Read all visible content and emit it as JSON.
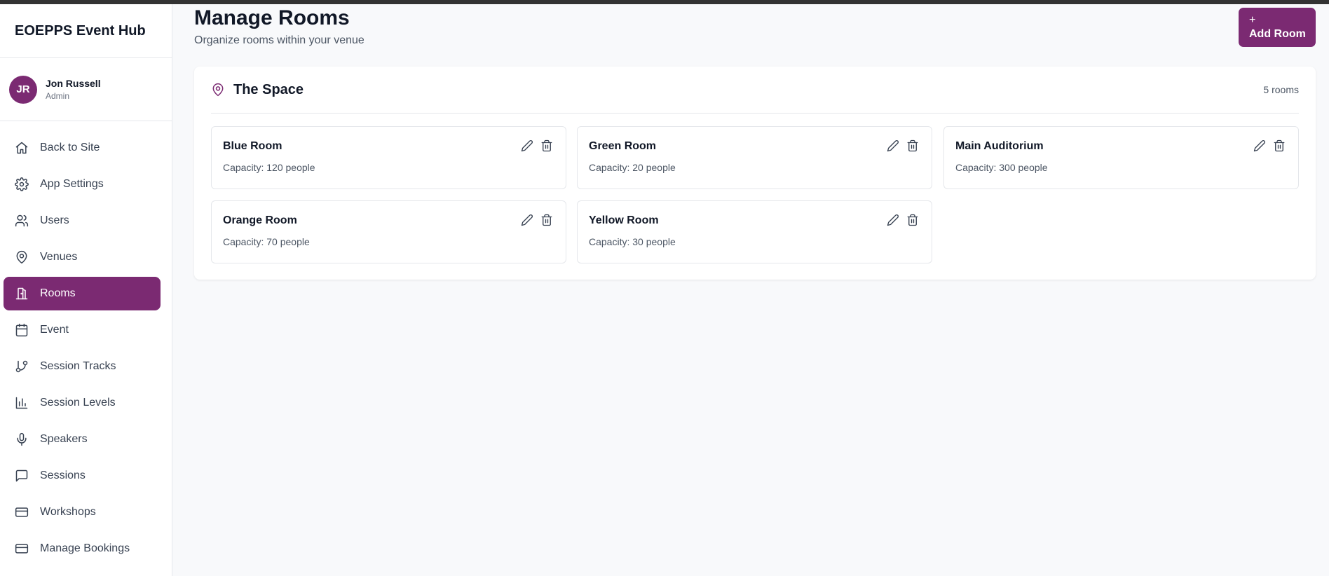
{
  "app": {
    "brand": "EOEPPS Event Hub"
  },
  "user": {
    "initials": "JR",
    "name": "Jon Russell",
    "role": "Admin"
  },
  "nav": [
    {
      "label": "Back to Site",
      "icon": "home-icon",
      "active": false
    },
    {
      "label": "App Settings",
      "icon": "gear-icon",
      "active": false
    },
    {
      "label": "Users",
      "icon": "users-icon",
      "active": false
    },
    {
      "label": "Venues",
      "icon": "map-pin-icon",
      "active": false
    },
    {
      "label": "Rooms",
      "icon": "door-icon",
      "active": true
    },
    {
      "label": "Event",
      "icon": "calendar-icon",
      "active": false
    },
    {
      "label": "Session Tracks",
      "icon": "git-branch-icon",
      "active": false
    },
    {
      "label": "Session Levels",
      "icon": "bar-chart-icon",
      "active": false
    },
    {
      "label": "Speakers",
      "icon": "microphone-icon",
      "active": false
    },
    {
      "label": "Sessions",
      "icon": "chat-bubble-icon",
      "active": false
    },
    {
      "label": "Workshops",
      "icon": "card-icon",
      "active": false
    },
    {
      "label": "Manage Bookings",
      "icon": "card-icon",
      "active": false
    }
  ],
  "page": {
    "title": "Manage Rooms",
    "subtitle": "Organize rooms within your venue",
    "add_button": {
      "plus": "+",
      "label": "Add Room"
    }
  },
  "venue": {
    "name": "The Space",
    "room_count": "5 rooms",
    "rooms": [
      {
        "name": "Blue Room",
        "capacity": "Capacity: 120 people"
      },
      {
        "name": "Green Room",
        "capacity": "Capacity: 20 people"
      },
      {
        "name": "Main Auditorium",
        "capacity": "Capacity: 300 people"
      },
      {
        "name": "Orange Room",
        "capacity": "Capacity: 70 people"
      },
      {
        "name": "Yellow Room",
        "capacity": "Capacity: 30 people"
      }
    ]
  },
  "colors": {
    "accent": "#7b2a72",
    "background": "#f8f9fb",
    "text": "#111827"
  }
}
